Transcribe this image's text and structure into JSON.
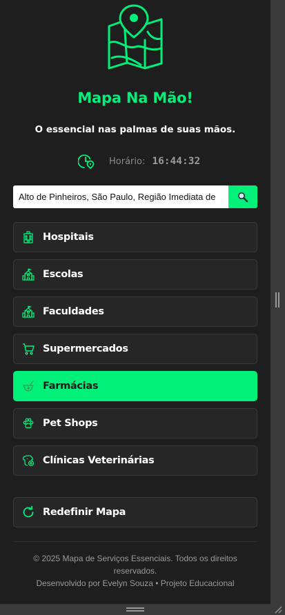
{
  "app": {
    "title": "Mapa Na Mão!",
    "tagline": "O essencial nas palmas de suas mãos.",
    "logo_icon": "map-pin-icon"
  },
  "clock": {
    "label": "Horário:",
    "time": "16:44:32",
    "icon": "clock-location-icon"
  },
  "search": {
    "value": "Alto de Pinheiros, São Paulo, Região Imediata de",
    "button_icon": "magnifier-icon"
  },
  "menu": {
    "items": [
      {
        "label": "Hospitais",
        "icon": "hospital-icon",
        "active": false
      },
      {
        "label": "Escolas",
        "icon": "school-icon",
        "active": false
      },
      {
        "label": "Faculdades",
        "icon": "school-icon",
        "active": false
      },
      {
        "label": "Supermercados",
        "icon": "cart-icon",
        "active": false
      },
      {
        "label": "Farmácias",
        "icon": "mortar-pestle-icon",
        "active": true
      },
      {
        "label": "Pet Shops",
        "icon": "paw-icon",
        "active": false
      },
      {
        "label": "Clínicas Veterinárias",
        "icon": "vet-dog-icon",
        "active": false
      }
    ],
    "reset_label": "Redefinir Mapa",
    "reset_icon": "refresh-icon"
  },
  "footer": {
    "copyright": "© 2025 Mapa de Serviços Essenciais. Todos os direitos reservados.",
    "credits": "Desenvolvido por Evelyn Souza • Projeto Educacional"
  },
  "colors": {
    "accent": "#00f07a",
    "background": "#1e1e1e",
    "button_bg": "#262626",
    "muted_text": "#9a9a9a"
  }
}
